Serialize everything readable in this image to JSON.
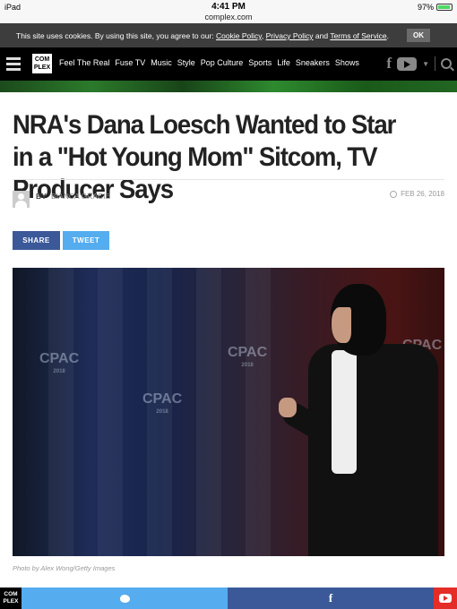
{
  "status_bar": {
    "device": "iPad",
    "time": "4:41 PM",
    "url": "complex.com",
    "battery": "97%"
  },
  "cookie_banner": {
    "message": "This site uses cookies. By using this site, you agree to our:",
    "cookie_policy": "Cookie Policy",
    "privacy_policy": "Privacy Policy",
    "and": "and",
    "terms": "Terms of Service",
    "ok_label": "OK"
  },
  "nav": {
    "logo_top": "COM",
    "logo_bottom": "PLEX",
    "items": [
      "Feel The Real",
      "Fuse TV",
      "Music",
      "Style",
      "Pop Culture",
      "Sports",
      "Life",
      "Sneakers",
      "Shows"
    ],
    "facebook": "f"
  },
  "article": {
    "title": "NRA's Dana Loesch Wanted to Star in a \"Hot Young Mom\" Sitcom, TV Producer Says",
    "by": "BY",
    "author": "BIANCA GRACIE",
    "date": "FEB 26, 2018",
    "share_label": "SHARE",
    "tweet_label": "TWEET",
    "photo_caption": "Photo by Alex Wong/Getty Images",
    "photo_signage": [
      "CPAC",
      "CPAC",
      "CPAC",
      "CPAC"
    ],
    "photo_signage_year": "2018"
  },
  "bottom_bar": {
    "logo_top": "COM",
    "logo_bottom": "PLEX",
    "facebook": "f"
  },
  "colors": {
    "facebook": "#3b5998",
    "twitter": "#55acee",
    "youtube": "#e52d27",
    "nav_bg": "#000000"
  }
}
